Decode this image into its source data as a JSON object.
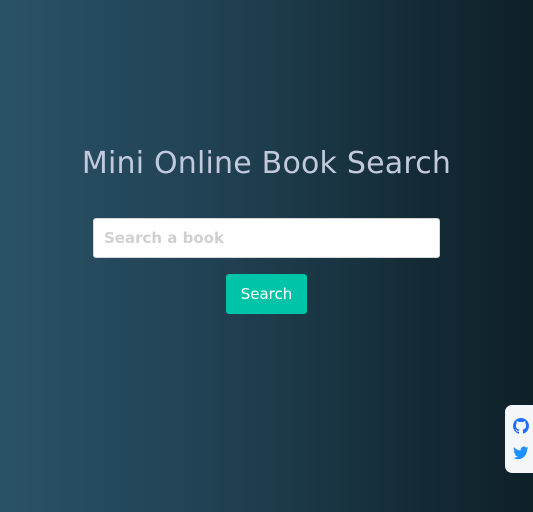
{
  "page": {
    "title": "Mini Online Book Search"
  },
  "search": {
    "placeholder": "Search a book",
    "value": "",
    "button_label": "Search"
  },
  "social": {
    "items": [
      {
        "name": "GitHub",
        "icon": "github-icon",
        "color": "#1e6fff"
      },
      {
        "name": "Twitter",
        "icon": "twitter-icon",
        "color": "#1e90ff"
      }
    ]
  },
  "colors": {
    "accent": "#00c4a7",
    "title_text": "#c3c9dc",
    "background_start": "#2a5267",
    "background_end": "#0e2028"
  }
}
